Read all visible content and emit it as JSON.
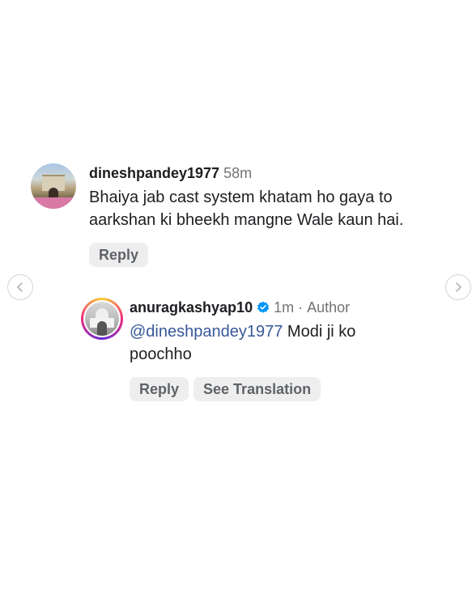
{
  "comments": [
    {
      "username": "dineshpandey1977",
      "time": "58m",
      "text_lines": [
        "Bhaiya jab cast system khatam ho gaya to",
        "aarkshan ki bheekh mangne Wale kaun hai."
      ],
      "actions": [
        "Reply"
      ]
    },
    {
      "username": "anuragkashyap10",
      "verified": true,
      "time": "1m",
      "separator": "·",
      "role": "Author",
      "mention": "@dineshpandey1977",
      "text_line1": "Modi ji ko",
      "text_line2": "poochho",
      "actions": [
        "Reply",
        "See Translation"
      ]
    }
  ],
  "navigation": {
    "prev_icon": "chevron-left-icon",
    "next_icon": "chevron-right-icon"
  },
  "colors": {
    "mention": "#385898",
    "verified_badge": "#0095f6",
    "meta_text": "#737373",
    "pill_background": "#eeeeee"
  }
}
